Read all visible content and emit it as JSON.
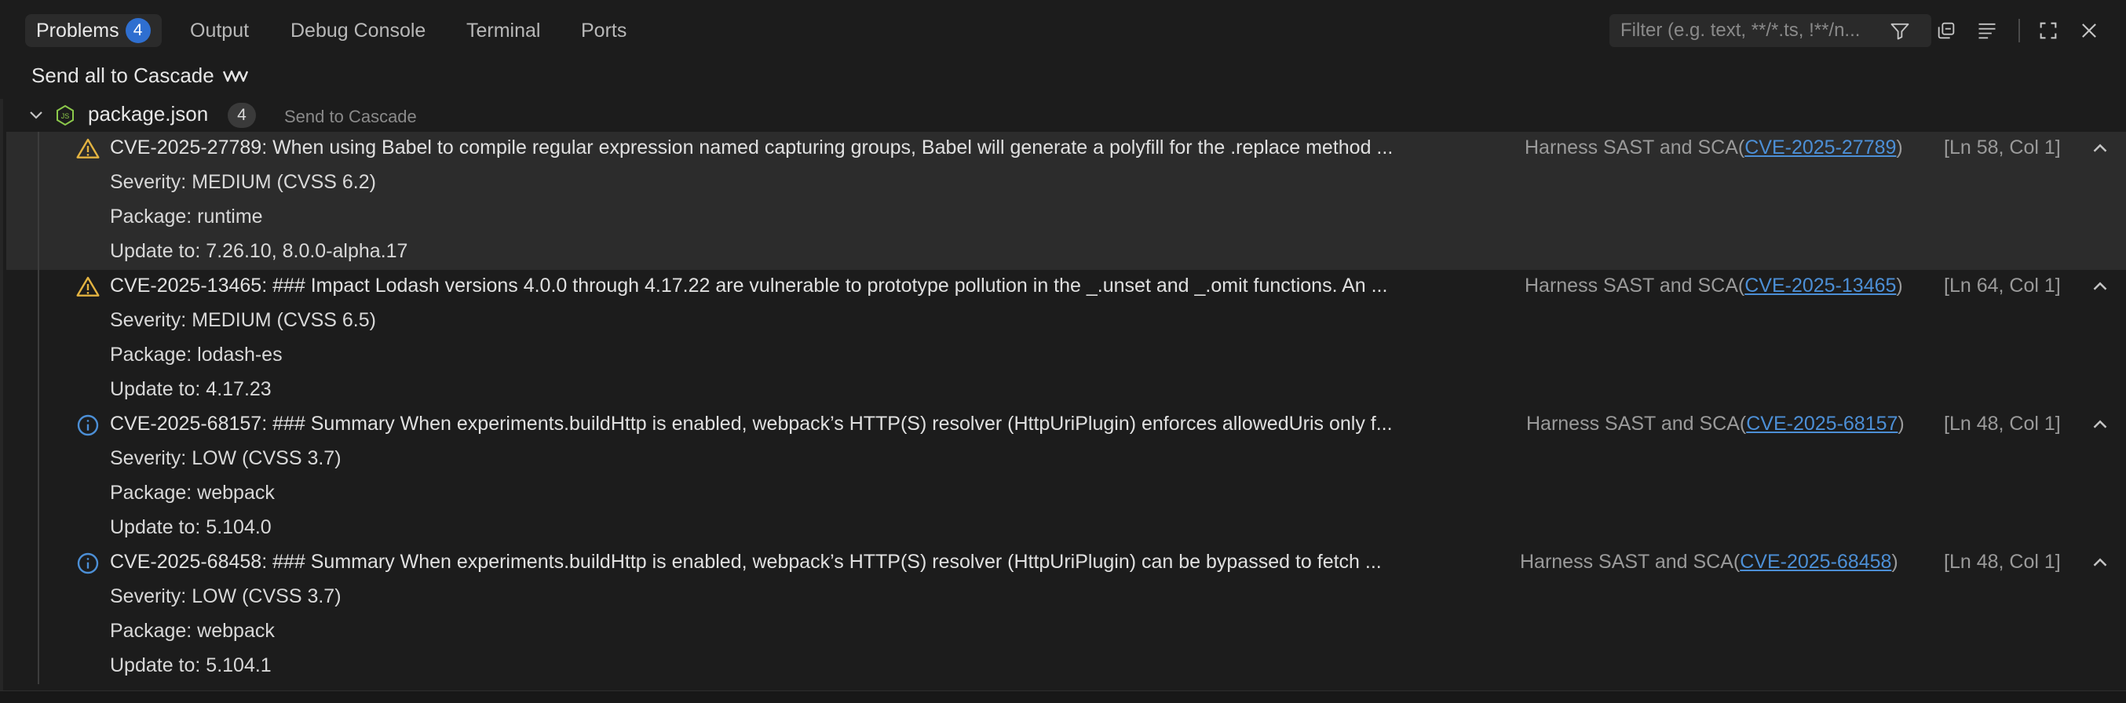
{
  "tabs": [
    {
      "label": "Problems",
      "count": "4",
      "active": true
    },
    {
      "label": "Output"
    },
    {
      "label": "Debug Console"
    },
    {
      "label": "Terminal"
    },
    {
      "label": "Ports"
    }
  ],
  "filter": {
    "placeholder": "Filter (e.g. text, **/*.ts, !**/n..."
  },
  "toolbar_icons": [
    "filter-icon",
    "collapse-all-icon",
    "view-as-list-icon",
    "maximize-icon",
    "close-icon"
  ],
  "send_all_label": "Send all to Cascade",
  "file": {
    "name": "package.json",
    "count": "4",
    "send_label": "Send to Cascade"
  },
  "problems": [
    {
      "severity_icon": "warning-icon",
      "title": "CVE-2025-27789: When using Babel to compile regular expression named capturing groups, Babel will generate a polyfill for the .replace method ...",
      "source": "Harness SAST and SCA(",
      "code": "CVE-2025-27789",
      "source_end": ")",
      "location": "[Ln 58, Col 1]",
      "details": [
        "Severity: MEDIUM (CVSS 6.2)",
        "Package: runtime",
        "Update to: 7.26.10, 8.0.0-alpha.17"
      ]
    },
    {
      "severity_icon": "warning-icon",
      "title": "CVE-2025-13465: ### Impact Lodash versions 4.0.0 through 4.17.22 are vulnerable to prototype pollution in the _.unset and _.omit functions. An ...",
      "source": "Harness SAST and SCA(",
      "code": "CVE-2025-13465",
      "source_end": ")",
      "location": "[Ln 64, Col 1]",
      "details": [
        "Severity: MEDIUM (CVSS 6.5)",
        "Package: lodash-es",
        "Update to: 4.17.23"
      ]
    },
    {
      "severity_icon": "info-icon",
      "title": "CVE-2025-68157: ### Summary When experiments.buildHttp is enabled, webpack’s HTTP(S) resolver (HttpUriPlugin) enforces allowedUris only f...",
      "source": "Harness SAST and SCA(",
      "code": "CVE-2025-68157",
      "source_end": ")",
      "location": "[Ln 48, Col 1]",
      "details": [
        "Severity: LOW (CVSS 3.7)",
        "Package: webpack",
        "Update to: 5.104.0"
      ]
    },
    {
      "severity_icon": "info-icon",
      "title": "CVE-2025-68458: ### Summary When experiments.buildHttp is enabled, webpack’s HTTP(S) resolver (HttpUriPlugin) can be bypassed to fetch ...",
      "source": "Harness SAST and SCA(",
      "code": "CVE-2025-68458",
      "source_end": ")",
      "location": "[Ln 48, Col 1]",
      "details": [
        "Severity: LOW (CVSS 3.7)",
        "Package: webpack",
        "Update to: 5.104.1"
      ]
    }
  ],
  "colors": {
    "accent": "#2f6fd0",
    "warning": "#e3b341",
    "info": "#4c8fd6",
    "link": "#4c8fd6"
  }
}
